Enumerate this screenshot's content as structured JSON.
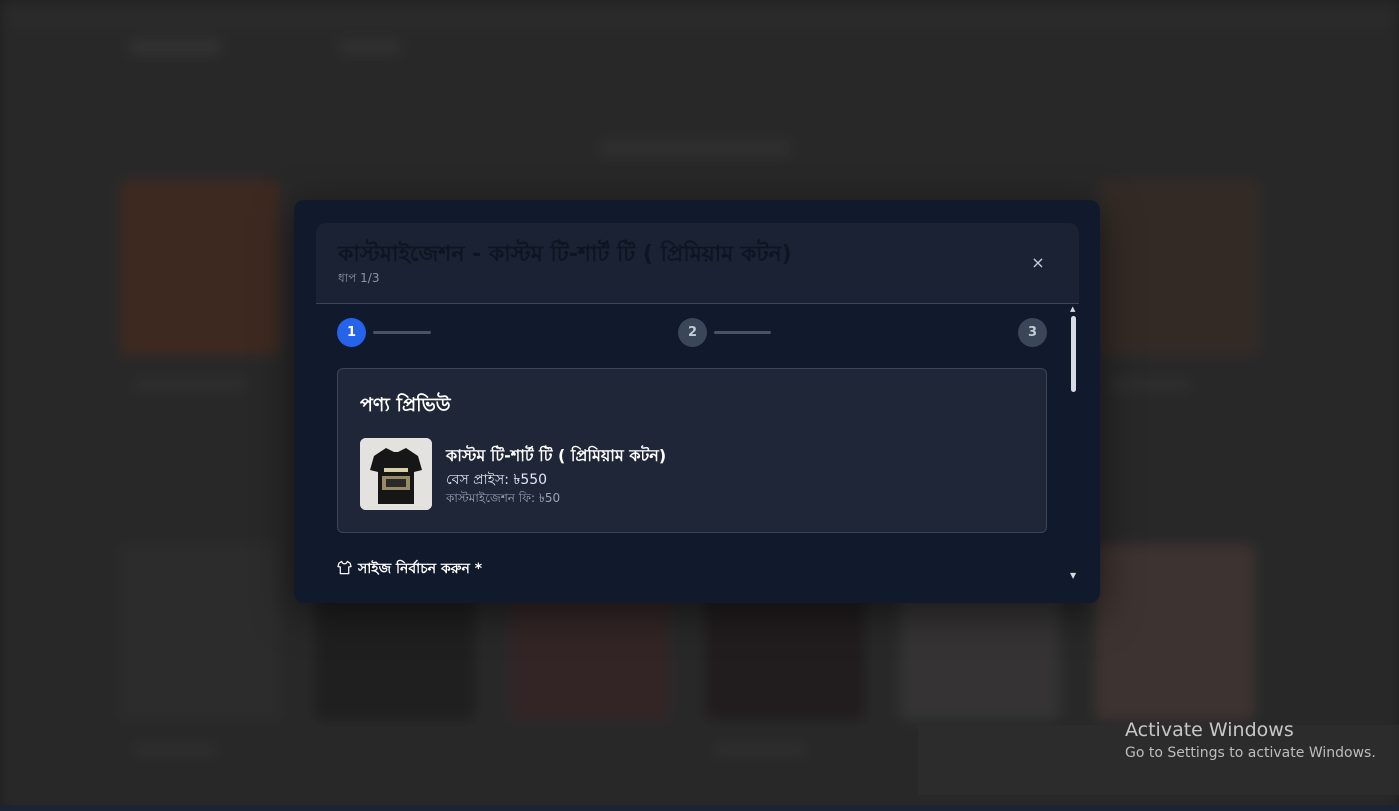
{
  "modal": {
    "title": "কাস্টমাইজেশন - কাস্টম টি-শার্ট টি ( প্রিমিয়াম কটন)",
    "step_label": "ধাপ 1/3",
    "close_label": "×"
  },
  "stepper": {
    "steps": [
      "1",
      "2",
      "3"
    ],
    "current": 1
  },
  "preview": {
    "heading": "পণ্য প্রিভিউ",
    "product_name": "কাস্টম টি-শার্ট টি ( প্রিমিয়াম কটন)",
    "base_price": "বেস প্রাইস: ৳550",
    "custom_fee": "কাস্টমাইজেশন ফি: ৳50"
  },
  "size": {
    "label": "সাইজ নির্বাচন করুন *"
  },
  "watermark": {
    "line1": "Activate Windows",
    "line2": "Go to Settings to activate Windows."
  },
  "colors": {
    "modal_bg": "#111a2c",
    "accent": "#2563eb",
    "card_bg": "#1e2638"
  }
}
